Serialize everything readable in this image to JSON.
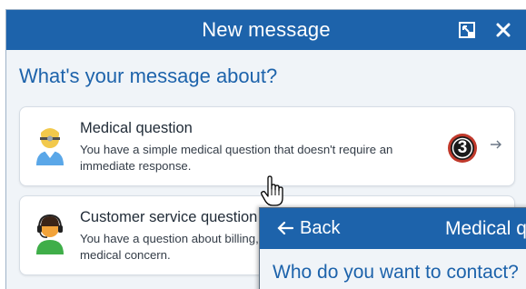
{
  "window": {
    "title": "New message",
    "heading": "What's your message about?",
    "icons": [
      "expand-icon",
      "close-icon"
    ]
  },
  "options": [
    {
      "title": "Medical question",
      "description": "You have a simple medical question that doesn't require an immediate response.",
      "icon": "doctor-avatar-icon"
    },
    {
      "title": "Customer service question",
      "description": "You have a question about billing, insurance, or another non-medical concern.",
      "icon": "customer-service-avatar-icon"
    }
  ],
  "step_badge": "3",
  "overlay": {
    "back_label": "Back",
    "title": "Medical question",
    "question": "Who do you want to contact?"
  },
  "colors": {
    "brand_blue": "#1d63ab",
    "background": "#f0f4f8",
    "badge_dark": "#1a1a1a",
    "badge_ring": "#c0392b"
  }
}
